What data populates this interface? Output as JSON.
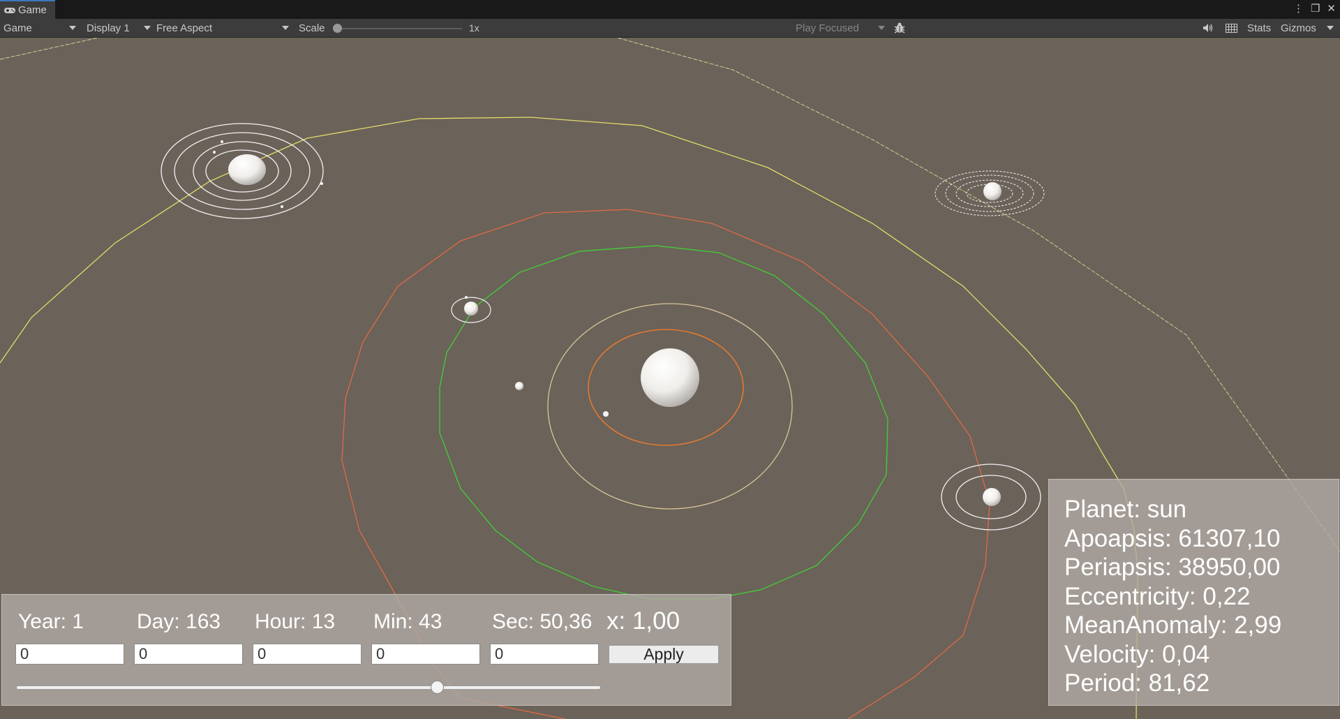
{
  "tab": {
    "label": "Game"
  },
  "toolbar": {
    "mode": "Game",
    "display": "Display 1",
    "aspect": "Free Aspect",
    "scale_label": "Scale",
    "scale_value": "1x",
    "play_mode": "Play Focused",
    "stats": "Stats",
    "gizmos": "Gizmos"
  },
  "time": {
    "year": "Year: 1",
    "day": "Day: 163",
    "hour": "Hour: 13",
    "min": "Min: 43",
    "sec": "Sec: 50,36",
    "multiplier": "x: 1,00",
    "inputs": [
      "0",
      "0",
      "0",
      "0",
      "0"
    ],
    "apply": "Apply",
    "slider_fraction": 0.72
  },
  "info": {
    "planet": "Planet: sun",
    "apoapsis": "Apoapsis: 61307,10",
    "periapsis": "Periapsis: 38950,00",
    "eccentricity": "Eccentricity: 0,22",
    "mean_anomaly": "MeanAnomaly: 2,99",
    "velocity": "Velocity: 0,04",
    "period": "Period: 81,62"
  },
  "colors": {
    "background": "#6b6259",
    "orbit_orange": "#e07a32",
    "orbit_tan": "#d9c69a",
    "orbit_green": "#45c83a",
    "orbit_red": "#e06a45",
    "orbit_yellow": "#e3dd6a",
    "moon_orbit": "#f2f2f2"
  }
}
